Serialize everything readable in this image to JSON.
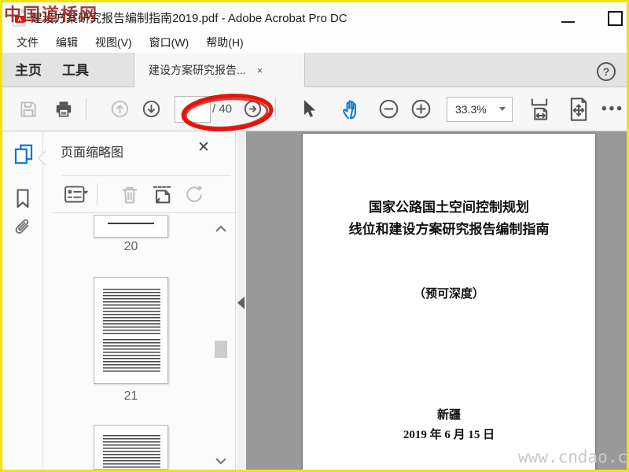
{
  "window": {
    "app_title": "建设方案研究报告编制指南2019.pdf - Adobe Acrobat Pro DC"
  },
  "menu": {
    "items": [
      "文件",
      "编辑",
      "视图(V)",
      "窗口(W)",
      "帮助(H)"
    ]
  },
  "tabs": {
    "home_label": "主页",
    "tools_label": "工具",
    "doc_label": "建设方案研究报告...",
    "doc_close_glyph": "×",
    "help_glyph": "?"
  },
  "toolbar": {
    "page_input_value": "",
    "page_total_label": "/ 40",
    "zoom_value": "33.3%",
    "more_glyph": "•••"
  },
  "panel": {
    "title": "页面缩略图",
    "close_glyph": "✕",
    "pages": [
      "20",
      "21"
    ]
  },
  "document": {
    "title_line1": "国家公路国土空间控制规划",
    "title_line2": "线位和建设方案研究报告编制指南",
    "subtitle": "（预可深度）",
    "region": "新疆",
    "date": "2019 年 6 月 15 日"
  },
  "watermarks": {
    "top_left": "中国道桥网",
    "bottom_right": "www.cndao.c"
  },
  "colors": {
    "accent_blue": "#0e76d1",
    "annotation_red": "#e2150d",
    "frame_yellow": "#f2e30a",
    "doc_background": "#999999"
  },
  "icons": {
    "save": "floppy-disk",
    "print": "printer",
    "previous_page": "circle-arrow-up",
    "next_page": "circle-arrow-down",
    "previous_view": "circle-arrow",
    "select": "cursor-arrow",
    "pan": "hand",
    "zoom_out": "circle-minus",
    "zoom_in": "circle-plus",
    "fit_width": "fit-width-page",
    "fit_page": "fit-page-arrows",
    "sidebar": [
      "page-thumbnails",
      "bookmarks",
      "attachments"
    ],
    "panel_tools": [
      "options-list",
      "trash",
      "crop-pages",
      "rotate"
    ]
  }
}
